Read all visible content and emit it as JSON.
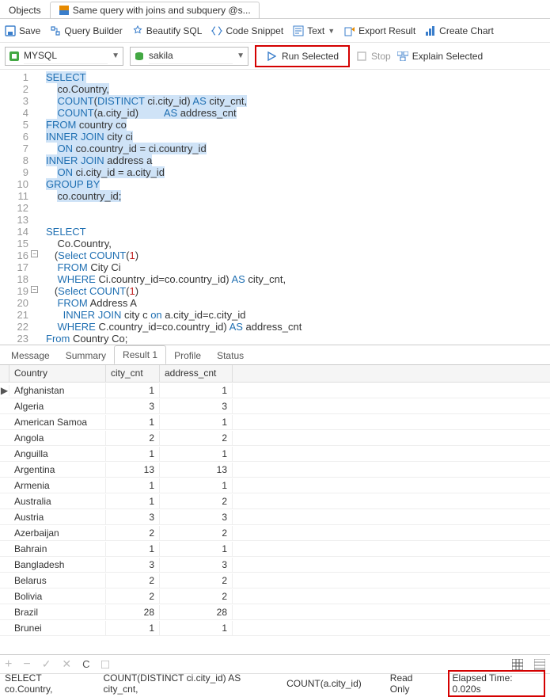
{
  "topTabs": {
    "objects": "Objects",
    "query": "Same query with joins and subquery @s..."
  },
  "toolbar": {
    "save": "Save",
    "queryBuilder": "Query Builder",
    "beautify": "Beautify SQL",
    "snippet": "Code Snippet",
    "text": "Text",
    "export": "Export Result",
    "chart": "Create Chart"
  },
  "conn": {
    "connName": "MYSQL",
    "dbName": "sakila",
    "runSelected": "Run Selected",
    "stop": "Stop",
    "explain": "Explain Selected"
  },
  "editor": {
    "lines": [
      {
        "n": 1,
        "seg": [
          {
            "t": "SELECT",
            "c": "kw hl"
          }
        ]
      },
      {
        "n": 2,
        "seg": [
          {
            "t": "    ",
            "c": ""
          },
          {
            "t": "co.Country,",
            "c": "id hl"
          }
        ]
      },
      {
        "n": 3,
        "seg": [
          {
            "t": "    ",
            "c": ""
          },
          {
            "t": "COUNT",
            "c": "fn hl"
          },
          {
            "t": "(",
            "c": "id hl"
          },
          {
            "t": "DISTINCT",
            "c": "kw hl"
          },
          {
            "t": " ci.city_id) ",
            "c": "id hl"
          },
          {
            "t": "AS",
            "c": "kw hl"
          },
          {
            "t": " city_cnt,",
            "c": "id hl"
          }
        ]
      },
      {
        "n": 4,
        "seg": [
          {
            "t": "    ",
            "c": ""
          },
          {
            "t": "COUNT",
            "c": "fn hl"
          },
          {
            "t": "(a.city_id)         ",
            "c": "id hl"
          },
          {
            "t": "AS",
            "c": "kw hl"
          },
          {
            "t": " address_cnt",
            "c": "id hl"
          }
        ]
      },
      {
        "n": 5,
        "seg": [
          {
            "t": "FROM",
            "c": "kw hl"
          },
          {
            "t": " country co",
            "c": "id hl"
          }
        ]
      },
      {
        "n": 6,
        "seg": [
          {
            "t": "INNER JOIN",
            "c": "kw hl"
          },
          {
            "t": " city ci",
            "c": "id hl"
          }
        ]
      },
      {
        "n": 7,
        "seg": [
          {
            "t": "    ",
            "c": ""
          },
          {
            "t": "ON",
            "c": "kw hl"
          },
          {
            "t": " co.country_id = ci.country_id",
            "c": "id hl"
          }
        ]
      },
      {
        "n": 8,
        "seg": [
          {
            "t": "INNER JOIN",
            "c": "kw hl"
          },
          {
            "t": " address a",
            "c": "id hl"
          }
        ]
      },
      {
        "n": 9,
        "seg": [
          {
            "t": "    ",
            "c": ""
          },
          {
            "t": "ON",
            "c": "kw hl"
          },
          {
            "t": " ci.city_id = a.city_id",
            "c": "id hl"
          }
        ]
      },
      {
        "n": 10,
        "seg": [
          {
            "t": "GROUP BY",
            "c": "kw hl"
          }
        ]
      },
      {
        "n": 11,
        "seg": [
          {
            "t": "    ",
            "c": ""
          },
          {
            "t": "co.country_id;",
            "c": "id hl"
          }
        ]
      },
      {
        "n": 12,
        "seg": [
          {
            "t": "",
            "c": ""
          }
        ]
      },
      {
        "n": 13,
        "seg": [
          {
            "t": "",
            "c": ""
          }
        ]
      },
      {
        "n": 14,
        "seg": [
          {
            "t": "SELECT",
            "c": "kw"
          }
        ]
      },
      {
        "n": 15,
        "seg": [
          {
            "t": "    Co.Country,",
            "c": "id"
          }
        ]
      },
      {
        "n": 16,
        "fold": true,
        "seg": [
          {
            "t": "   (",
            "c": "id"
          },
          {
            "t": "Select",
            "c": "kw"
          },
          {
            "t": " ",
            "c": ""
          },
          {
            "t": "COUNT",
            "c": "fn"
          },
          {
            "t": "(",
            "c": "id"
          },
          {
            "t": "1",
            "c": "num"
          },
          {
            "t": ")",
            "c": "id"
          }
        ]
      },
      {
        "n": 17,
        "seg": [
          {
            "t": "    ",
            "c": ""
          },
          {
            "t": "FROM",
            "c": "kw"
          },
          {
            "t": " City Ci",
            "c": "id"
          }
        ]
      },
      {
        "n": 18,
        "seg": [
          {
            "t": "    ",
            "c": ""
          },
          {
            "t": "WHERE",
            "c": "kw"
          },
          {
            "t": " Ci.country_id=co.country_id) ",
            "c": "id"
          },
          {
            "t": "AS",
            "c": "kw"
          },
          {
            "t": " city_cnt,",
            "c": "id"
          }
        ]
      },
      {
        "n": 19,
        "fold": true,
        "seg": [
          {
            "t": "   (",
            "c": "id"
          },
          {
            "t": "Select",
            "c": "kw"
          },
          {
            "t": " ",
            "c": ""
          },
          {
            "t": "COUNT",
            "c": "fn"
          },
          {
            "t": "(",
            "c": "id"
          },
          {
            "t": "1",
            "c": "num"
          },
          {
            "t": ")",
            "c": "id"
          }
        ]
      },
      {
        "n": 20,
        "seg": [
          {
            "t": "    ",
            "c": ""
          },
          {
            "t": "FROM",
            "c": "kw"
          },
          {
            "t": " Address A",
            "c": "id"
          }
        ]
      },
      {
        "n": 21,
        "seg": [
          {
            "t": "      ",
            "c": ""
          },
          {
            "t": "INNER JOIN",
            "c": "kw"
          },
          {
            "t": " city c ",
            "c": "id"
          },
          {
            "t": "on",
            "c": "kw"
          },
          {
            "t": " a.city_id=c.city_id",
            "c": "id"
          }
        ]
      },
      {
        "n": 22,
        "seg": [
          {
            "t": "    ",
            "c": ""
          },
          {
            "t": "WHERE",
            "c": "kw"
          },
          {
            "t": " C.country_id=co.country_id) ",
            "c": "id"
          },
          {
            "t": "AS",
            "c": "kw"
          },
          {
            "t": " address_cnt",
            "c": "id"
          }
        ]
      },
      {
        "n": 23,
        "seg": [
          {
            "t": "From",
            "c": "kw"
          },
          {
            "t": " Country Co;",
            "c": "id"
          }
        ]
      }
    ]
  },
  "resultTabs": {
    "message": "Message",
    "summary": "Summary",
    "result1": "Result 1",
    "profile": "Profile",
    "status": "Status"
  },
  "grid": {
    "headers": {
      "country": "Country",
      "city_cnt": "city_cnt",
      "address_cnt": "address_cnt"
    },
    "rows": [
      {
        "sel": true,
        "country": "Afghanistan",
        "city_cnt": 1,
        "address_cnt": 1
      },
      {
        "country": "Algeria",
        "city_cnt": 3,
        "address_cnt": 3
      },
      {
        "country": "American Samoa",
        "city_cnt": 1,
        "address_cnt": 1
      },
      {
        "country": "Angola",
        "city_cnt": 2,
        "address_cnt": 2
      },
      {
        "country": "Anguilla",
        "city_cnt": 1,
        "address_cnt": 1
      },
      {
        "country": "Argentina",
        "city_cnt": 13,
        "address_cnt": 13
      },
      {
        "country": "Armenia",
        "city_cnt": 1,
        "address_cnt": 1
      },
      {
        "country": "Australia",
        "city_cnt": 1,
        "address_cnt": 2
      },
      {
        "country": "Austria",
        "city_cnt": 3,
        "address_cnt": 3
      },
      {
        "country": "Azerbaijan",
        "city_cnt": 2,
        "address_cnt": 2
      },
      {
        "country": "Bahrain",
        "city_cnt": 1,
        "address_cnt": 1
      },
      {
        "country": "Bangladesh",
        "city_cnt": 3,
        "address_cnt": 3
      },
      {
        "country": "Belarus",
        "city_cnt": 2,
        "address_cnt": 2
      },
      {
        "country": "Bolivia",
        "city_cnt": 2,
        "address_cnt": 2
      },
      {
        "country": "Brazil",
        "city_cnt": 28,
        "address_cnt": 28
      },
      {
        "country": "Brunei",
        "city_cnt": 1,
        "address_cnt": 1
      }
    ]
  },
  "status": {
    "sql1": "SELECT     co.Country,",
    "sql2": "COUNT(DISTINCT ci.city_id) AS city_cnt,",
    "sql3": "COUNT(a.city_id)",
    "readOnly": "Read Only",
    "elapsed": "Elapsed Time: 0.020s"
  },
  "icons": {
    "tabIcon": "tab-icon"
  }
}
